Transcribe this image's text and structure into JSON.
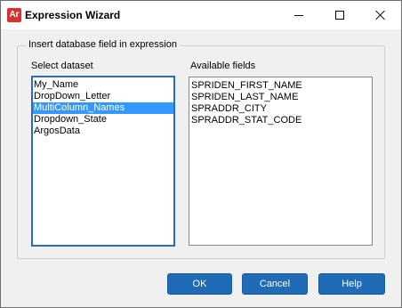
{
  "window": {
    "title": "Expression Wizard",
    "app_icon_text": "Ar"
  },
  "group": {
    "legend": "Insert database field in expression"
  },
  "datasets": {
    "label": "Select dataset",
    "items": [
      "My_Name",
      "DropDown_Letter",
      "MultiColumn_Names",
      "Dropdown_State",
      "ArgosData"
    ],
    "selected": "MultiColumn_Names"
  },
  "fields": {
    "label": "Available fields",
    "items": [
      "SPRIDEN_FIRST_NAME",
      "SPRIDEN_LAST_NAME",
      "SPRADDR_CITY",
      "SPRADDR_STAT_CODE"
    ]
  },
  "buttons": {
    "ok": "OK",
    "cancel": "Cancel",
    "help": "Help"
  },
  "colors": {
    "accent": "#1f6bb6",
    "selection": "#3399ff",
    "app_icon": "#d7322f"
  },
  "icons": {
    "app": "argos-app-icon",
    "minimize": "minimize-icon",
    "maximize": "maximize-icon",
    "close": "close-icon"
  }
}
